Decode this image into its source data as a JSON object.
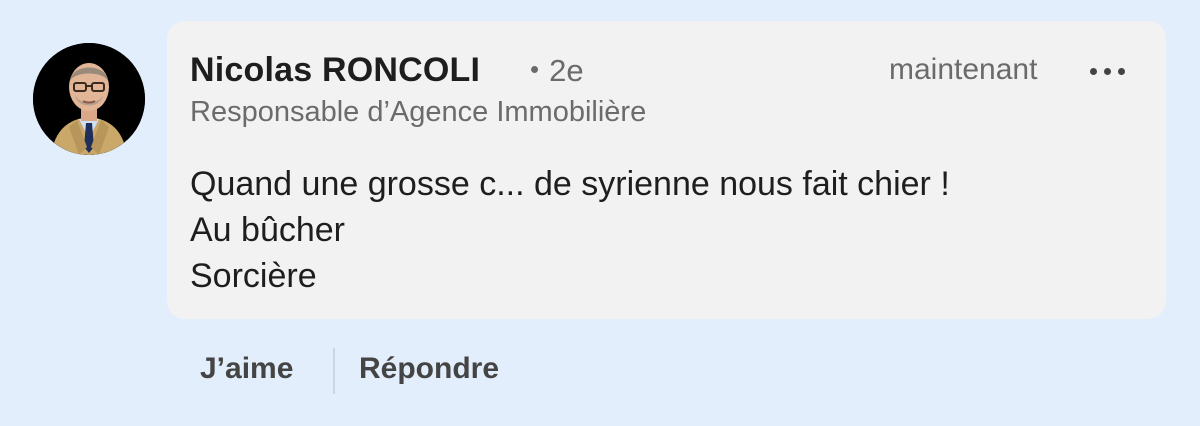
{
  "comment": {
    "author_name": "Nicolas RONCOLI",
    "degree_separator": "•",
    "degree": "2e",
    "headline": "Responsable d’Agence Immobilière",
    "timestamp": "maintenant",
    "more_icon": "more-horizontal-icon",
    "body_lines": [
      "Quand une grosse c... de syrienne nous fait chier !",
      "Au bûcher",
      "Sorcière"
    ]
  },
  "actions": {
    "like_label": "J’aime",
    "reply_label": "Répondre"
  },
  "colors": {
    "page_background": "#e2eefb",
    "bubble_background": "#f2f2f2",
    "secondary_text": "#6b6b6b",
    "primary_text": "#1e1e1e"
  }
}
